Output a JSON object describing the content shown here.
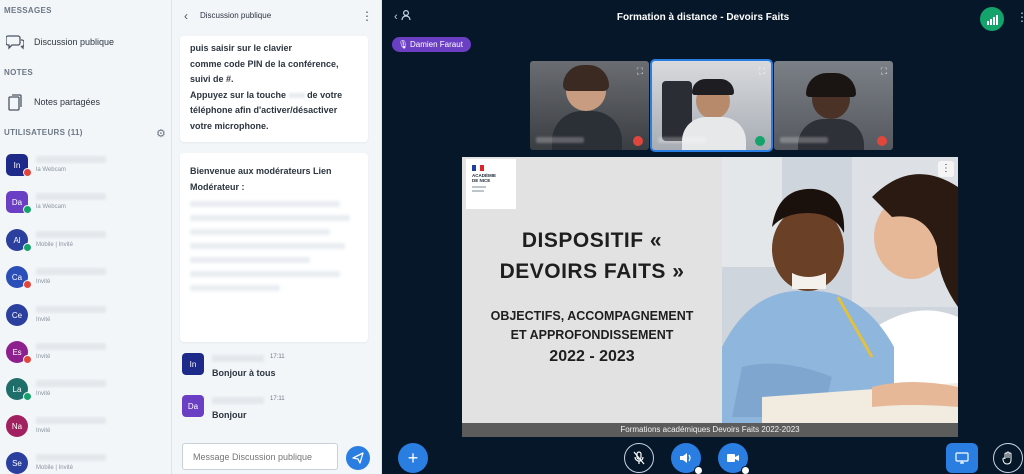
{
  "left": {
    "messages_header": "MESSAGES",
    "public_chat_label": "Discussion publique",
    "notes_header": "NOTES",
    "shared_notes_label": "Notes partagées",
    "users_header": "UTILISATEURS (11)",
    "users": [
      {
        "initials": "In",
        "status": "la Webcam",
        "color": "#1e2a8a",
        "badge": "#e0463c",
        "shape": "square"
      },
      {
        "initials": "Da",
        "status": "la Webcam",
        "color": "#6b3fc4",
        "badge": "#14a36b",
        "shape": "square"
      },
      {
        "initials": "Al",
        "status": "Mobile | Invité",
        "color": "#2a3f9e",
        "badge": "#14a36b",
        "shape": "round"
      },
      {
        "initials": "Ca",
        "status": "Invité",
        "color": "#2b4fb8",
        "badge": "#e0463c",
        "shape": "round"
      },
      {
        "initials": "Ce",
        "status": "Invité",
        "color": "#2a3f9e",
        "badge": "",
        "shape": "round"
      },
      {
        "initials": "Es",
        "status": "Invité",
        "color": "#8e1f8e",
        "badge": "#e0463c",
        "shape": "round"
      },
      {
        "initials": "La",
        "status": "Invité",
        "color": "#1f6e6a",
        "badge": "#14a36b",
        "shape": "round"
      },
      {
        "initials": "Na",
        "status": "Invité",
        "color": "#a02060",
        "badge": "",
        "shape": "round"
      },
      {
        "initials": "Se",
        "status": "Mobile | Invité",
        "color": "#2a3f9e",
        "badge": "",
        "shape": "round"
      }
    ]
  },
  "chat": {
    "title": "Discussion publique",
    "card1_lines": [
      "puis saisir sur le clavier",
      "comme code PIN de la conférence,",
      "suivi de #.",
      "Appuyez sur la touche",
      "de votre",
      "téléphone afin d'activer/désactiver",
      "votre microphone."
    ],
    "card2_lines": [
      "Bienvenue aux modérateurs Lien",
      "Modérateur :"
    ],
    "messages": [
      {
        "initials": "In",
        "color": "#1e2a8a",
        "time": "17:11",
        "text": "Bonjour à tous"
      },
      {
        "initials": "Da",
        "color": "#6b3fc4",
        "time": "17:11",
        "text": "Bonjour"
      }
    ],
    "input_placeholder": "Message Discussion publique"
  },
  "main": {
    "title": "Formation à distance - Devoirs Faits",
    "talking": "Damien Faraut",
    "slide": {
      "academy": "ACADÉMIE DE NICE",
      "title_line1": "DISPOSITIF «",
      "title_line2": "DEVOIRS FAITS »",
      "subtitle_line1": "OBJECTIFS, ACCOMPAGNEMENT",
      "subtitle_line2": "ET APPROFONDISSEMENT",
      "year": "2022 - 2023",
      "footer": "Formations académiques Devoirs Faits 2022-2023"
    },
    "colors": {
      "accent": "#2a7de1",
      "talk": "#6b3fc4",
      "connection": "#14a36b",
      "muted": "#e0463c"
    }
  }
}
